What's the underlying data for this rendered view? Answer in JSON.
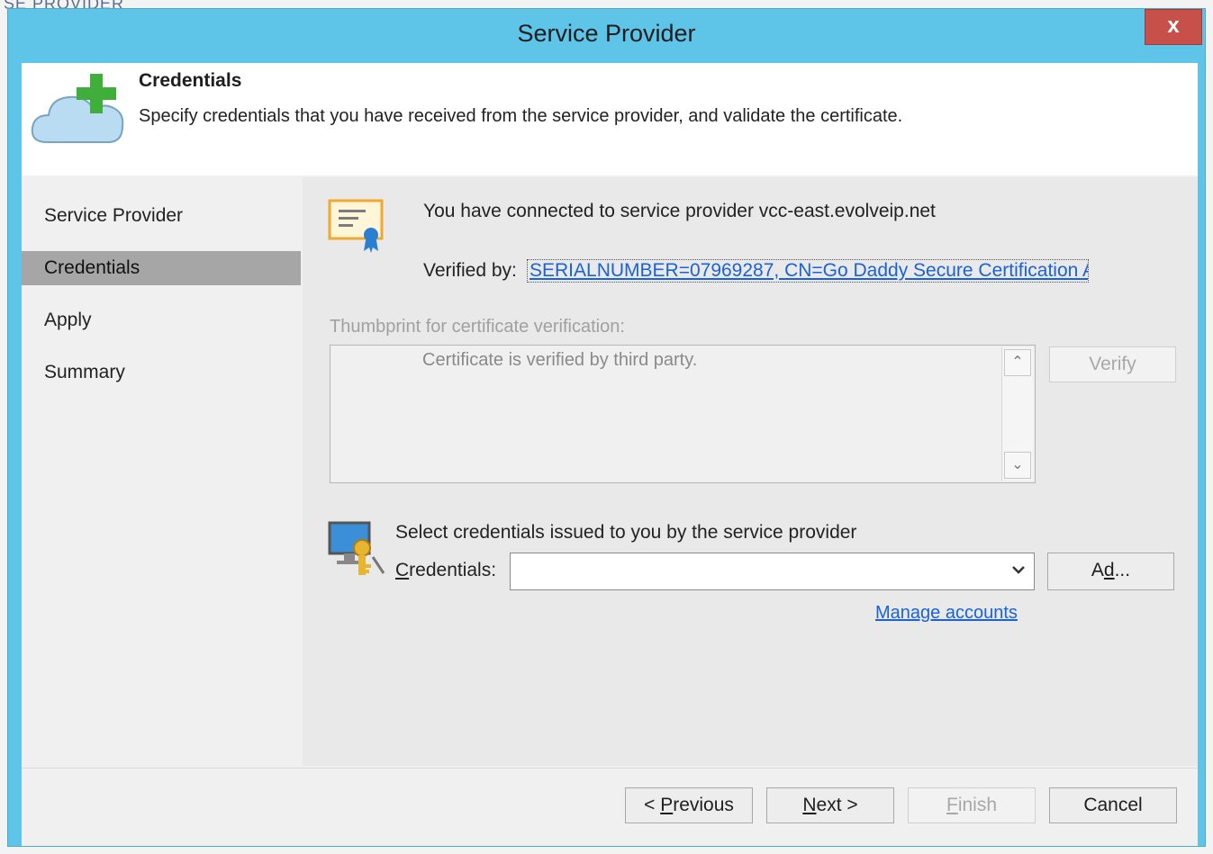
{
  "background": {
    "partial_text": "SE PROVIDER"
  },
  "window": {
    "title": "Service Provider",
    "close_label": "x"
  },
  "header": {
    "title": "Credentials",
    "subtitle": "Specify credentials that you have received from the service provider, and validate the certificate."
  },
  "nav": {
    "items": [
      {
        "label": "Service Provider",
        "active": false
      },
      {
        "label": "Credentials",
        "active": true
      },
      {
        "label": "Apply",
        "active": false
      },
      {
        "label": "Summary",
        "active": false
      }
    ]
  },
  "main": {
    "connected_text": "You have connected to service provider vcc-east.evolveip.net",
    "verified_label": "Verified by:",
    "verified_value": "SERIALNUMBER=07969287, CN=Go Daddy Secure Certification A",
    "thumbprint_label": "Thumbprint for certificate verification:",
    "thumbprint_text": "Certificate is verified by third party.",
    "verify_button": "Verify",
    "credentials_title": "Select credentials issued to you by the service provider",
    "credentials_label_prefix": "C",
    "credentials_label_rest": "redentials:",
    "credentials_value": "",
    "add_button_prefix": "A",
    "add_button_u": "d",
    "add_button_rest": "d...",
    "manage_link": "Manage accounts"
  },
  "footer": {
    "previous_pre": "< ",
    "previous_u": "P",
    "previous_rest": "revious",
    "next_u": "N",
    "next_rest": "ext >",
    "finish_u": "F",
    "finish_rest": "inish",
    "cancel": "Cancel"
  },
  "colors": {
    "titlebar": "#5fc5e8",
    "close": "#c7504a",
    "nav_active": "#a6a6a6",
    "link": "#1a62d6"
  }
}
